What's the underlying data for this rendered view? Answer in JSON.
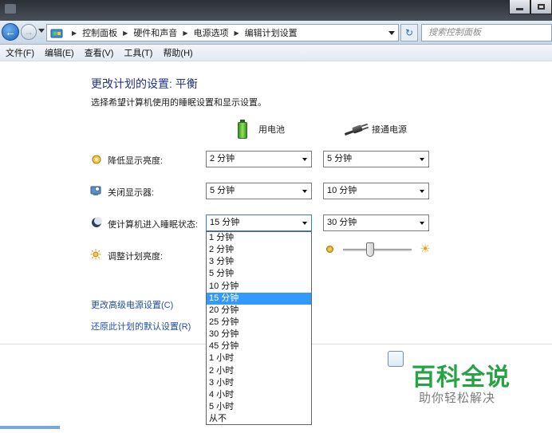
{
  "breadcrumb": [
    "控制面板",
    "硬件和声音",
    "电源选项",
    "编辑计划设置"
  ],
  "search": {
    "placeholder": "搜索控制面板"
  },
  "menu": [
    "文件(F)",
    "编辑(E)",
    "查看(V)",
    "工具(T)",
    "帮助(H)"
  ],
  "page": {
    "title": "更改计划的设置: 平衡",
    "description": "选择希望计算机使用的睡眠设置和显示设置。"
  },
  "columns": {
    "battery": "用电池",
    "plugged": "接通电源"
  },
  "settings": [
    {
      "label": "降低显示亮度:",
      "icon": "brightness-icon",
      "battery": "2 分钟",
      "plugged": "5 分钟"
    },
    {
      "label": "关闭显示器:",
      "icon": "monitor-icon",
      "battery": "5 分钟",
      "plugged": "10 分钟"
    },
    {
      "label": "使计算机进入睡眠状态:",
      "icon": "sleep-icon",
      "battery": "15 分钟",
      "plugged": "30 分钟"
    },
    {
      "label": "调整计划亮度:",
      "icon": "sun-icon"
    }
  ],
  "dropdown_options": [
    "1 分钟",
    "2 分钟",
    "3 分钟",
    "5 分钟",
    "10 分钟",
    "15 分钟",
    "20 分钟",
    "25 分钟",
    "30 分钟",
    "45 分钟",
    "1 小时",
    "2 小时",
    "3 小时",
    "4 小时",
    "5 小时",
    "从不"
  ],
  "dropdown_selected": "15 分钟",
  "links": {
    "advanced": "更改高级电源设置(C)",
    "restore": "还原此计划的默认设置(R)"
  },
  "watermark": {
    "title": "百科全说",
    "subtitle": "助你轻松解决"
  }
}
